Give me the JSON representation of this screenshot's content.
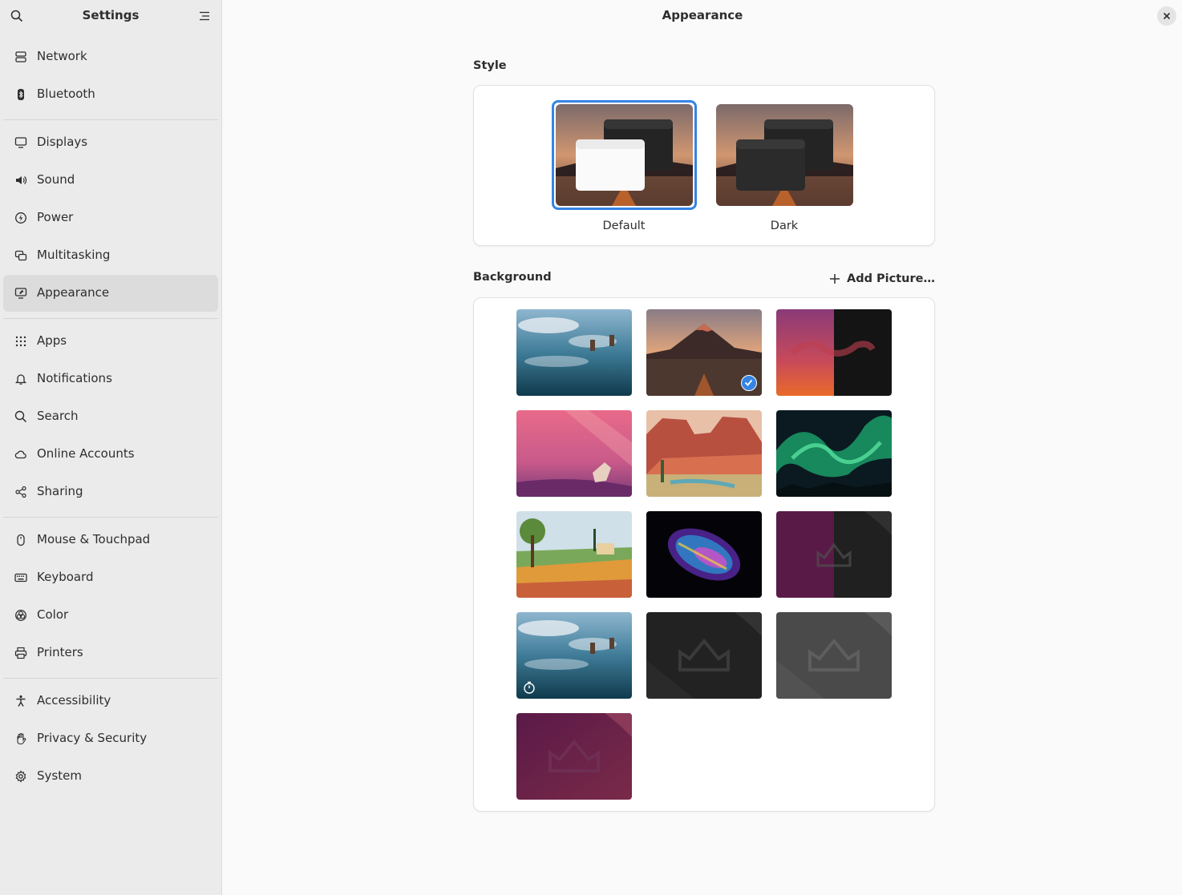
{
  "sidebar": {
    "title": "Settings",
    "items": [
      {
        "label": "Network",
        "icon": "network-icon"
      },
      {
        "label": "Bluetooth",
        "icon": "bluetooth-icon"
      },
      {
        "label": "Displays",
        "icon": "display-icon"
      },
      {
        "label": "Sound",
        "icon": "speaker-icon"
      },
      {
        "label": "Power",
        "icon": "power-icon"
      },
      {
        "label": "Multitasking",
        "icon": "multitasking-icon"
      },
      {
        "label": "Appearance",
        "icon": "appearance-icon",
        "active": true
      },
      {
        "label": "Apps",
        "icon": "apps-grid-icon"
      },
      {
        "label": "Notifications",
        "icon": "bell-icon"
      },
      {
        "label": "Search",
        "icon": "search-icon"
      },
      {
        "label": "Online Accounts",
        "icon": "cloud-icon"
      },
      {
        "label": "Sharing",
        "icon": "share-icon"
      },
      {
        "label": "Mouse & Touchpad",
        "icon": "mouse-icon"
      },
      {
        "label": "Keyboard",
        "icon": "keyboard-icon"
      },
      {
        "label": "Color",
        "icon": "color-icon"
      },
      {
        "label": "Printers",
        "icon": "printer-icon"
      },
      {
        "label": "Accessibility",
        "icon": "accessibility-icon"
      },
      {
        "label": "Privacy & Security",
        "icon": "hand-icon"
      },
      {
        "label": "System",
        "icon": "gear-icon"
      }
    ]
  },
  "main": {
    "title": "Appearance",
    "style": {
      "label": "Style",
      "options": [
        {
          "label": "Default",
          "selected": true
        },
        {
          "label": "Dark",
          "selected": false
        }
      ]
    },
    "background": {
      "label": "Background",
      "add_label": "Add Picture…",
      "selected_index": 1,
      "timed_index": 9,
      "wallpapers": [
        "lake-reflection",
        "mountain-sunset",
        "split-purple-dark",
        "pink-numbat",
        "desert-mesa",
        "green-aurora",
        "countryside",
        "glass-bulb",
        "split-plum-dark",
        "lake-reflection-timed",
        "dark-crown",
        "gray-crown",
        "plum-crown"
      ]
    }
  },
  "colors": {
    "accent": "#3584e4",
    "sidebar_bg": "#ebebeb",
    "main_bg": "#fafafa"
  }
}
